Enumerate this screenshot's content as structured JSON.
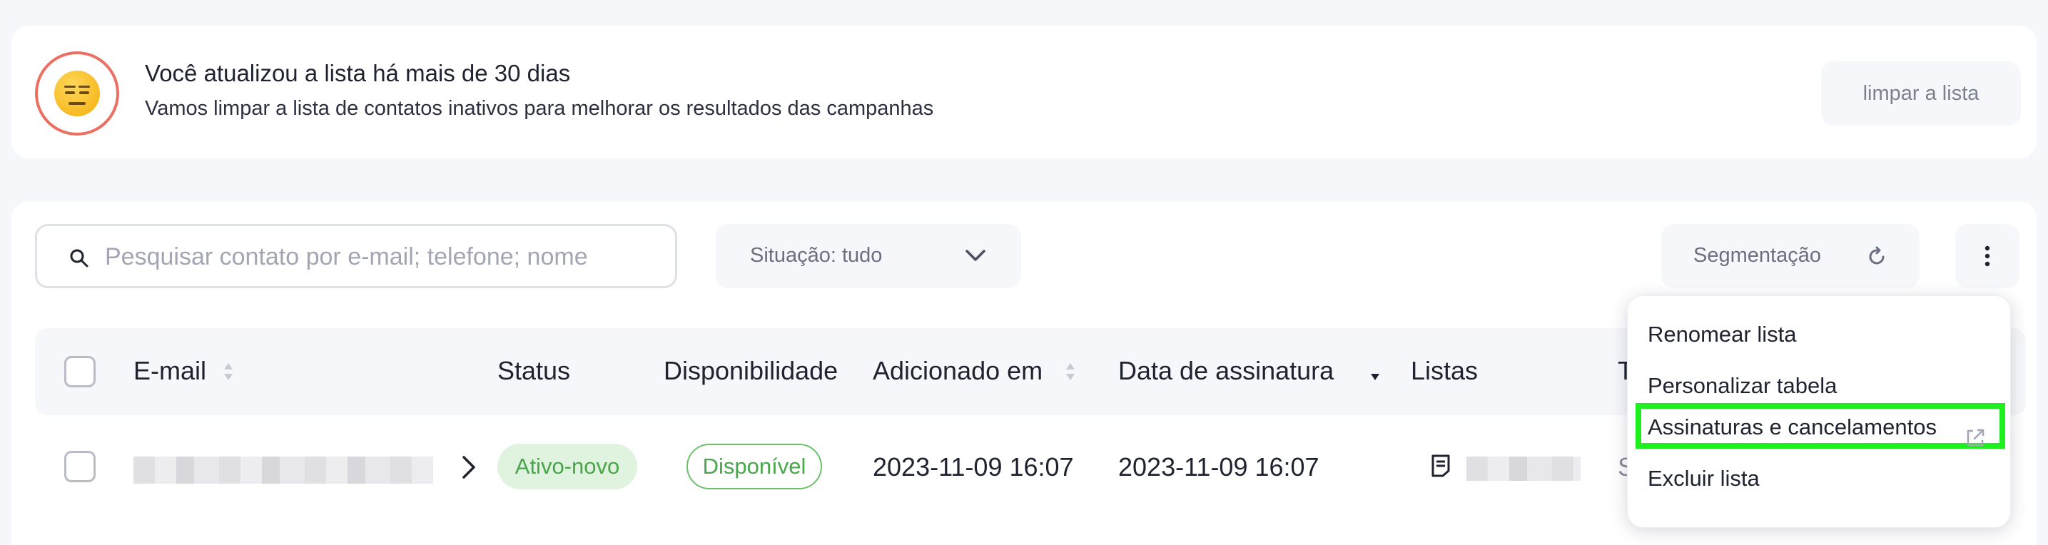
{
  "banner": {
    "title": "Você atualizou a lista há mais de 30 dias",
    "subtitle": "Vamos limpar a lista de contatos inativos para melhorar os resultados das campanhas",
    "emoji": "expressionless-face-icon",
    "button_label": "limpar a lista"
  },
  "toolbar": {
    "search_placeholder": "Pesquisar contato por e-mail; telefone; nome",
    "search_value": "",
    "filter_label": "Situação: tudo",
    "segmentation_label": "Segmentação"
  },
  "table": {
    "columns": [
      "E-mail",
      "Status",
      "Disponibilidade",
      "Adicionado em",
      "Data de assinatura",
      "Listas",
      "T"
    ],
    "rows": [
      {
        "email": "",
        "status": "Ativo-novo",
        "availability": "Disponível",
        "added_at": "2023-11-09 16:07",
        "subscribed_at": "2023-11-09 16:07",
        "lists": "",
        "extra": "S"
      }
    ]
  },
  "menu": {
    "items": [
      "Renomear lista",
      "Personalizar tabela",
      "Assinaturas e cancelamentos",
      "Excluir lista"
    ]
  },
  "colors": {
    "accent_green": "#4aa64a",
    "highlight": "#1fef1f",
    "emoji_ring": "#ec6f63"
  }
}
